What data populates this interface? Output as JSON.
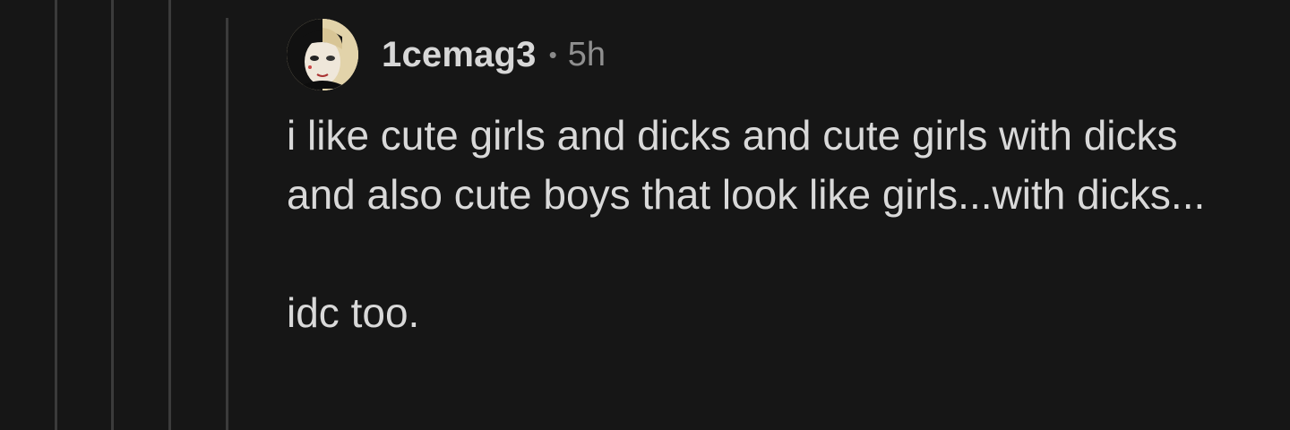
{
  "comment": {
    "author": "1cemag3",
    "separator": "•",
    "age": "5h",
    "paragraphs": [
      "i like cute girls and dicks and cute girls with dicks and also cute boys that look like girls...with dicks...",
      "idc too."
    ]
  },
  "icons": {
    "avatar": "user-avatar"
  },
  "colors": {
    "background": "#161616",
    "thread_line": "#3b3b3b",
    "text": "#d9d9d9",
    "meta": "#8f8f8f"
  }
}
